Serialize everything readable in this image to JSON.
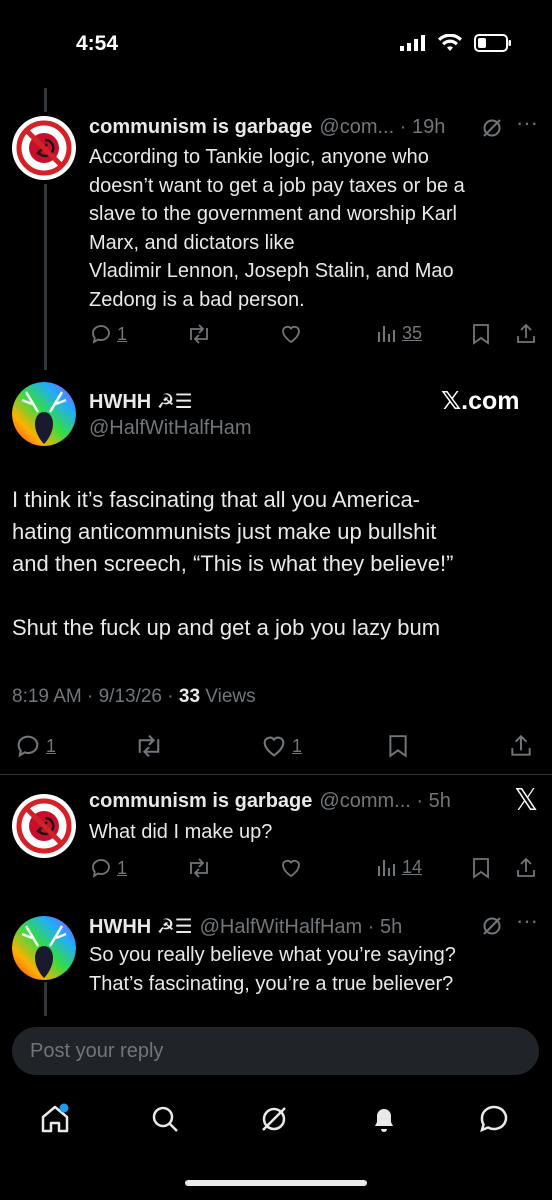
{
  "status_bar": {
    "time": "4:54"
  },
  "tweets": [
    {
      "name": "communism is garbage",
      "handle": "@com...",
      "time": "19h",
      "text_lines": [
        "According to Tankie logic, anyone who",
        "doesn’t want to get a job pay taxes or be a",
        "slave to the government and worship Karl",
        "Marx, and dictators like",
        "Vladimir Lennon, Joseph Stalin, and Mao",
        "Zedong is a bad person."
      ],
      "replies": "1",
      "views": "35"
    },
    {
      "name": "HWHH ☭☰",
      "handle": "@HalfWitHalfHam",
      "badge": "𝕏.com",
      "paragraph1": [
        "I think it’s fascinating that all you America-",
        "hating anticommunists just make up bullshit",
        "and then screech, “This is what they believe!”"
      ],
      "paragraph2": "Shut the fuck up and get a job you lazy bum",
      "timestamp": "8:19 AM · 9/13/26 · ",
      "views_count": "33",
      "views_label": " Views",
      "replies": "1",
      "likes": "1"
    },
    {
      "name": "communism is garbage",
      "handle": "@comm...",
      "time": "5h",
      "text": "What did I make up?",
      "replies": "1",
      "views": "14"
    },
    {
      "name": "HWHH ☭☰",
      "handle": "@HalfWitHalfHam",
      "time": "5h",
      "text_lines": [
        "So you really believe what you’re saying?",
        "That’s fascinating, you’re a true believer?"
      ]
    }
  ],
  "reply_box": {
    "placeholder": "Post your reply"
  },
  "tabbar": [
    "home-icon",
    "search-icon",
    "grok-icon",
    "notifications-icon",
    "messages-icon"
  ]
}
